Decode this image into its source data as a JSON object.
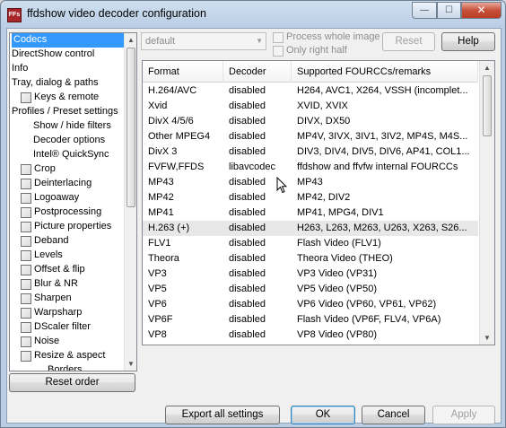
{
  "window": {
    "title": "ffdshow video decoder configuration",
    "icon_text": "FFs"
  },
  "title_buttons": {
    "minimize": "—",
    "maximize": "☐",
    "close": "✕"
  },
  "tree": {
    "items": [
      {
        "label": "Codecs",
        "selected": true,
        "checkbox": false,
        "indent": 0
      },
      {
        "label": "DirectShow control",
        "checkbox": false,
        "indent": 0
      },
      {
        "label": "Info",
        "checkbox": false,
        "indent": 0
      },
      {
        "label": "Tray, dialog & paths",
        "checkbox": false,
        "indent": 0
      },
      {
        "label": "Keys & remote",
        "checkbox": true,
        "indent": 1
      },
      {
        "label": "Profiles / Preset settings",
        "checkbox": false,
        "indent": 0
      },
      {
        "label": "Show / hide filters",
        "checkbox": false,
        "indent": 2
      },
      {
        "label": "Decoder options",
        "checkbox": false,
        "indent": 2
      },
      {
        "label": "Intel® QuickSync",
        "checkbox": false,
        "indent": 2
      },
      {
        "label": "Crop",
        "checkbox": true,
        "indent": 1
      },
      {
        "label": "Deinterlacing",
        "checkbox": true,
        "indent": 1
      },
      {
        "label": "Logoaway",
        "checkbox": true,
        "indent": 1
      },
      {
        "label": "Postprocessing",
        "checkbox": true,
        "indent": 1
      },
      {
        "label": "Picture properties",
        "checkbox": true,
        "indent": 1
      },
      {
        "label": "Deband",
        "checkbox": true,
        "indent": 1
      },
      {
        "label": "Levels",
        "checkbox": true,
        "indent": 1
      },
      {
        "label": "Offset & flip",
        "checkbox": true,
        "indent": 1
      },
      {
        "label": "Blur & NR",
        "checkbox": true,
        "indent": 1
      },
      {
        "label": "Sharpen",
        "checkbox": true,
        "indent": 1
      },
      {
        "label": "Warpsharp",
        "checkbox": true,
        "indent": 1
      },
      {
        "label": "DScaler filter",
        "checkbox": true,
        "indent": 1
      },
      {
        "label": "Noise",
        "checkbox": true,
        "indent": 1
      },
      {
        "label": "Resize & aspect",
        "checkbox": true,
        "indent": 1
      },
      {
        "label": "Borders",
        "checkbox": false,
        "indent": 3
      }
    ]
  },
  "reset_order_label": "Reset order",
  "preset": {
    "value": "default"
  },
  "options": {
    "process_whole_image": "Process whole image",
    "only_right_half": "Only right half"
  },
  "reset_label": "Reset",
  "help_label": "Help",
  "list": {
    "headers": [
      "Format",
      "Decoder",
      "Supported FOURCCs/remarks"
    ],
    "rows": [
      {
        "format": "H.264/AVC",
        "decoder": "disabled",
        "remarks": "H264, AVC1, X264, VSSH (incomplet..."
      },
      {
        "format": "Xvid",
        "decoder": "disabled",
        "remarks": "XVID, XVIX"
      },
      {
        "format": "DivX 4/5/6",
        "decoder": "disabled",
        "remarks": "DIVX, DX50"
      },
      {
        "format": "Other MPEG4",
        "decoder": "disabled",
        "remarks": "MP4V, 3IVX, 3IV1, 3IV2, MP4S, M4S..."
      },
      {
        "format": "DivX 3",
        "decoder": "disabled",
        "remarks": "DIV3, DIV4, DIV5, DIV6, AP41, COL1..."
      },
      {
        "format": "FVFW,FFDS",
        "decoder": "libavcodec",
        "remarks": "ffdshow and ffvfw internal FOURCCs"
      },
      {
        "format": "MP43",
        "decoder": "disabled",
        "remarks": "MP43"
      },
      {
        "format": "MP42",
        "decoder": "disabled",
        "remarks": "MP42, DIV2"
      },
      {
        "format": "MP41",
        "decoder": "disabled",
        "remarks": "MP41, MPG4, DIV1"
      },
      {
        "format": "H.263 (+)",
        "decoder": "disabled",
        "remarks": "H263, L263, M263, U263, X263, S26...",
        "hover": true
      },
      {
        "format": "FLV1",
        "decoder": "disabled",
        "remarks": "Flash Video (FLV1)"
      },
      {
        "format": "Theora",
        "decoder": "disabled",
        "remarks": "Theora Video (THEO)"
      },
      {
        "format": "VP3",
        "decoder": "disabled",
        "remarks": "VP3 Video (VP31)"
      },
      {
        "format": "VP5",
        "decoder": "disabled",
        "remarks": "VP5 Video (VP50)"
      },
      {
        "format": "VP6",
        "decoder": "disabled",
        "remarks": "VP6 Video (VP60, VP61, VP62)"
      },
      {
        "format": "VP6F",
        "decoder": "disabled",
        "remarks": "Flash Video (VP6F, FLV4, VP6A)"
      },
      {
        "format": "VP8",
        "decoder": "disabled",
        "remarks": "VP8 Video (VP80)"
      }
    ]
  },
  "footer": {
    "export_label": "Export all settings",
    "ok_label": "OK",
    "cancel_label": "Cancel",
    "apply_label": "Apply"
  },
  "colors": {
    "selection": "#3399ff",
    "titlebar": "#b9cde4",
    "close": "#c7513a"
  }
}
